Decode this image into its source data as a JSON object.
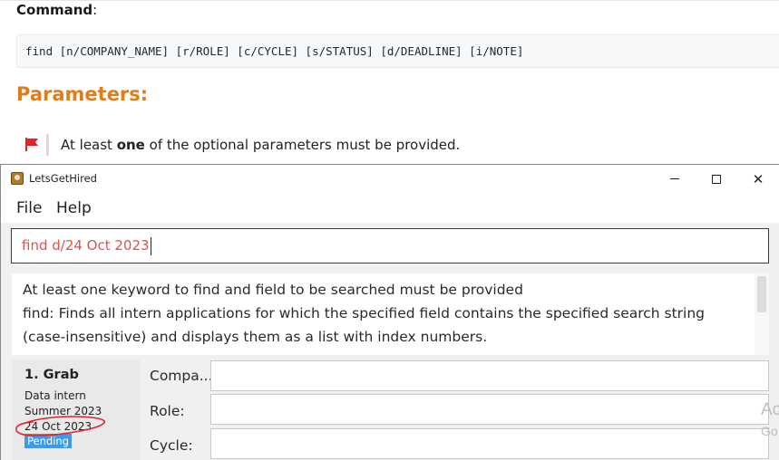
{
  "doc": {
    "command_heading_bold": "Command",
    "command_heading_rest": ":",
    "command_syntax": "find [n/COMPANY_NAME] [r/ROLE] [c/CYCLE] [s/STATUS] [d/DEADLINE] [i/NOTE]",
    "parameters_heading": "Parameters:",
    "note_prefix": "At least ",
    "note_bold": "one",
    "note_suffix": " of the optional parameters must be provided.",
    "note_icon": "red-flag-icon"
  },
  "window": {
    "title": "LetsGetHired",
    "controls": {
      "minimize": "minimize",
      "maximize": "maximize",
      "close": "✕"
    }
  },
  "menu": {
    "file": "File",
    "help": "Help"
  },
  "command_box": {
    "value": "find d/24 Oct 2023"
  },
  "result": {
    "lines": [
      "At least one keyword to find and field to be searched must be provided",
      "find: Finds all intern applications for which the specified field contains the specified search string",
      "(case-insensitive) and displays them as a list with index numbers."
    ]
  },
  "list": {
    "items": [
      {
        "title": "1.  Grab",
        "role": "Data intern",
        "cycle": "Summer 2023",
        "deadline": "24 Oct 2023",
        "status": "Pending"
      }
    ]
  },
  "details": {
    "labels": {
      "company": "Compa...",
      "role": "Role:",
      "cycle": "Cycle:"
    }
  },
  "watermark": {
    "line1": "Ac",
    "line2": "Go"
  },
  "colors": {
    "accent_orange": "#e07c1a",
    "command_text": "#d9534f",
    "status_badge": "#3d9be9",
    "annotation_red": "#e0242a"
  }
}
